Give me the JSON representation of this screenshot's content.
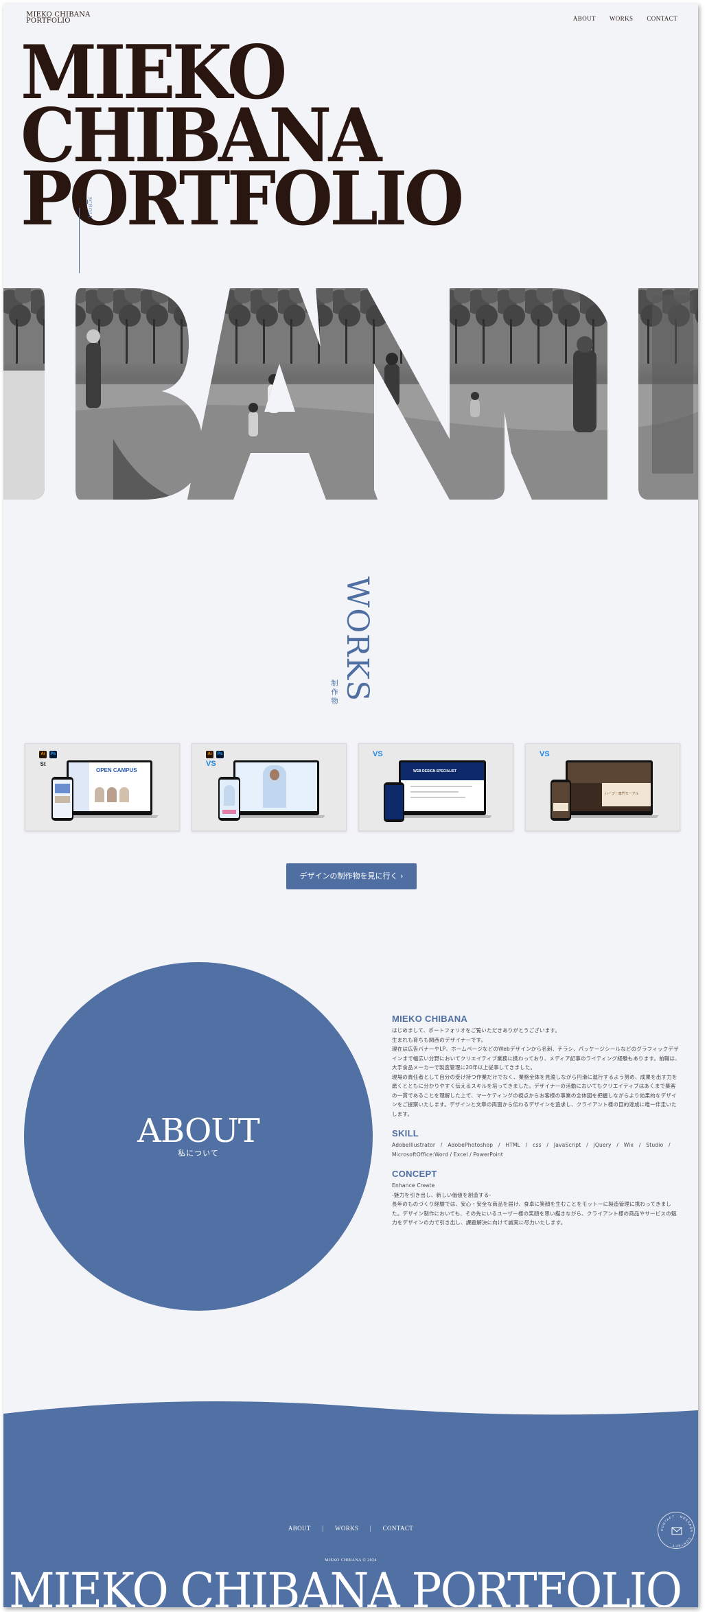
{
  "header": {
    "logo_line1": "MIEKO CHIBANA",
    "logo_line2": "PORTFOLIO",
    "nav": [
      "ABOUT",
      "WORKS",
      "CONTACT"
    ]
  },
  "hero": {
    "line1": "MIEKO CHIBANA",
    "line2": "PORTFOLIO",
    "scroll_label": "SCROLL"
  },
  "works": {
    "title": "WORKS",
    "subtitle": "制作物",
    "button_label": "デザインの制作物を見に行く ›",
    "cards": [
      {
        "tools": [
          "Ai",
          "Ps",
          "St"
        ],
        "caption": "OPEN CAMPUS"
      },
      {
        "tools": [
          "Ai",
          "Ps",
          "VS"
        ],
        "caption": ""
      },
      {
        "tools": [
          "VS"
        ],
        "caption": "WEB DESIGN SPECIALIST"
      },
      {
        "tools": [
          "VS"
        ],
        "caption": "ハーブー専門モーアル"
      }
    ]
  },
  "about": {
    "title": "ABOUT",
    "subtitle": "私について",
    "name_heading": "MIEKO CHIBANA",
    "intro": [
      "はじめまして、ポートフォリオをご覧いただきありがとうございます。",
      "生まれも育ちも関西のデザイナーです。",
      "現在は広告バナーやLP、ホームページなどのWebデザインから名刺、チラシ、パッケージシールなどのグラフィックデザインまで幅広い分野においてクリエイティブ業務に携わっており、メディア記事のライティング経験もあります。前職は、大手食品メーカーで製造管理に20年以上従事してきました。",
      "現場の責任者として自分の受け持つ作業だけでなく、業務全体を見渡しながら円滑に進行するよう努め、成果を出す力を磨くとともに分かりやすく伝えるスキルを培ってきました。デザイナーの活動においてもクリエイティブはあくまで集客の一貫であることを理解した上で、マーケティングの視点からお客様の事業の全体図を把握しながらより効果的なデザインをご提案いたします。デザインと文章の両面から伝わるデザインを追求し、クライアント様の目的達成に唯一伴走いたします。"
    ],
    "skill_heading": "SKILL",
    "skills": [
      "AdobeIllustrator　/　AdobePhotoshop　/　HTML　/　css　/　JavaScript　/　jQuery　/　Wix　/　Studio　/",
      "MicrosoftOffice:Word / Excel / PowerPoint"
    ],
    "concept_heading": "CONCEPT",
    "concept": [
      "Enhance Create",
      "-魅力を引き出し、新しい価値を創造する-",
      "長年のものづくり経験では、安心・安全な商品を届け、食卓に笑顔を生むことをモットーに製造管理に携わってきました。デザイン制作においても、その先にいるユーザー様の笑顔を思い描きながら、クライアント様の商品やサービスの魅力をデザインの力で引き出し、課題解決に向けて誠実に尽力いたします。"
    ]
  },
  "footer": {
    "nav": [
      "ABOUT",
      "WORKS",
      "CONTACT"
    ],
    "separator": "|",
    "copyright": "MIEKO CHIBANA © 2024",
    "big_title": "MIEKO CHIBANA PORTFOLIO",
    "contact_badge_text": "CONTACT · MESSAGE · CONTACT ·"
  },
  "colors": {
    "accent": "#5170a3",
    "background": "#f3f4f8",
    "hero_text": "#2a1610"
  }
}
